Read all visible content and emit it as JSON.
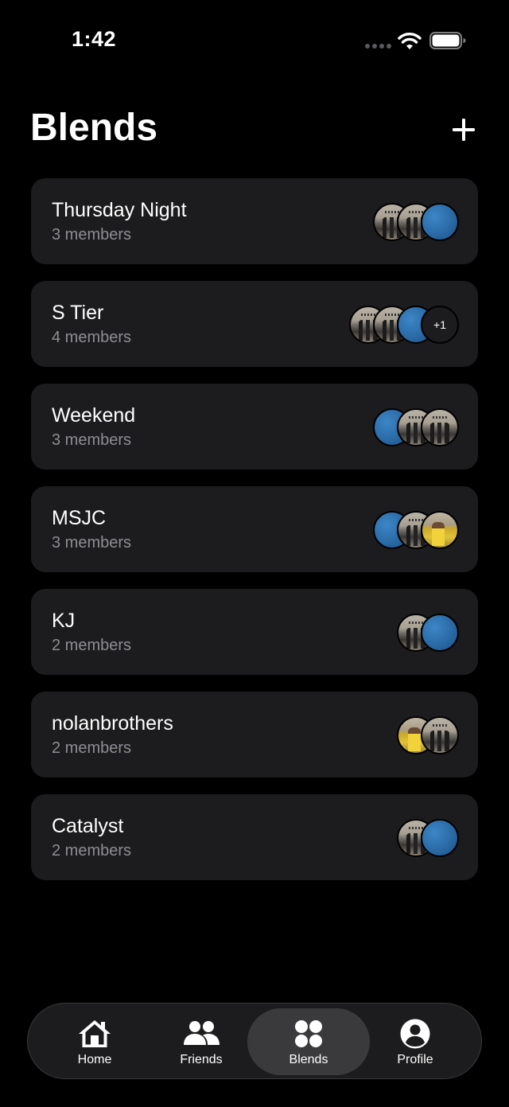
{
  "status_bar": {
    "time": "1:42"
  },
  "header": {
    "title": "Blends",
    "add_symbol": "+"
  },
  "blends": [
    {
      "name": "Thursday Night",
      "members": "3 members",
      "avatars": [
        "photo",
        "photo",
        "blue"
      ]
    },
    {
      "name": "S Tier",
      "members": "4 members",
      "avatars": [
        "photo",
        "photo",
        "blue",
        "more"
      ],
      "more_label": "+1"
    },
    {
      "name": "Weekend",
      "members": "3 members",
      "avatars": [
        "blue",
        "photo",
        "photo"
      ]
    },
    {
      "name": "MSJC",
      "members": "3 members",
      "avatars": [
        "blue",
        "photo",
        "yellow"
      ]
    },
    {
      "name": "KJ",
      "members": "2 members",
      "avatars": [
        "photo",
        "blue"
      ]
    },
    {
      "name": "nolanbrothers",
      "members": "2 members",
      "avatars": [
        "yellow",
        "photo"
      ]
    },
    {
      "name": "Catalyst",
      "members": "2 members",
      "avatars": [
        "photo",
        "blue"
      ]
    }
  ],
  "tab_bar": {
    "tabs": [
      {
        "label": "Home",
        "icon": "house-icon"
      },
      {
        "label": "Friends",
        "icon": "people-icon"
      },
      {
        "label": "Blends",
        "icon": "grid-dots-icon",
        "active": true
      },
      {
        "label": "Profile",
        "icon": "person-circle-icon"
      }
    ]
  },
  "colors": {
    "background": "#000000",
    "card": "#1c1c1e",
    "secondary_text": "#8e8e93",
    "active_tab": "#3a3a3c",
    "avatar_blue": "#2a6aa6"
  }
}
